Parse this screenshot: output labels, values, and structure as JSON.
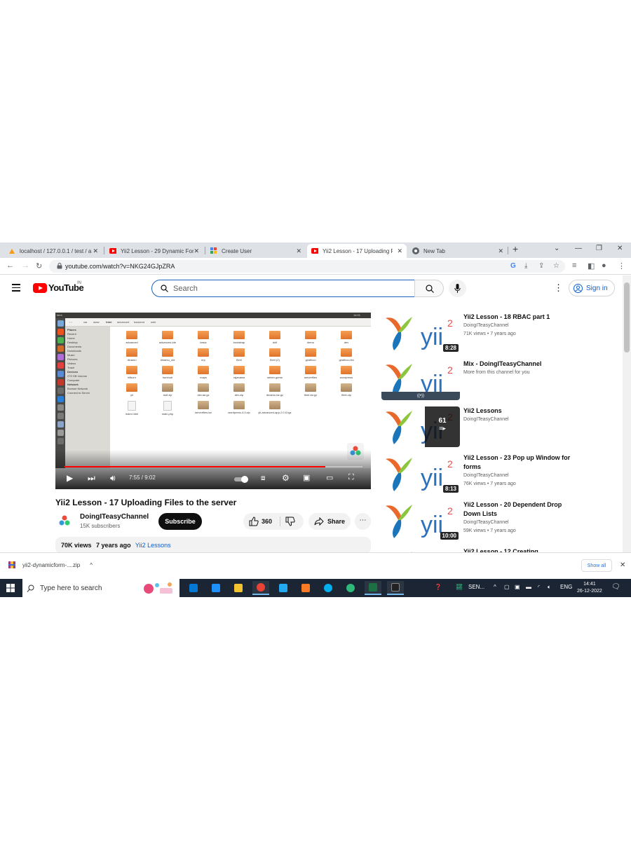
{
  "browser": {
    "tabs": [
      {
        "title": "localhost / 127.0.0.1 / test / a",
        "favicon": "phpmyadmin-icon",
        "active": false
      },
      {
        "title": "Yii2 Lesson - 29 Dynamic For",
        "favicon": "youtube-icon",
        "active": false
      },
      {
        "title": "Create User",
        "favicon": "yii-icon",
        "active": false
      },
      {
        "title": "Yii2 Lesson - 17 Uploading F",
        "favicon": "youtube-icon",
        "active": true
      },
      {
        "title": "New Tab",
        "favicon": "chrome-icon",
        "active": false
      }
    ],
    "new_tab_label": "+",
    "url": "youtube.com/watch?v=NKG24GJpZRA"
  },
  "youtube": {
    "logo_text": "YouTube",
    "country_code": "IN",
    "search_placeholder": "Search",
    "sign_in_label": "Sign in"
  },
  "video": {
    "title": "Yii2 Lesson - 17 Uploading Files to the server",
    "time_current": "7:55",
    "time_total": "9:02",
    "time_display": "7:55 / 9:02",
    "progress_fraction": 0.875,
    "channel_name": "DoingITeasyChannel",
    "subscribers": "15K subscribers",
    "subscribe_label": "Subscribe",
    "likes": "360",
    "share_label": "Share",
    "views": "70K views",
    "age": "7 years ago",
    "playlist": "Yii2 Lessons"
  },
  "file_manager": {
    "title": "html",
    "path": [
      "var",
      "www",
      "html",
      "advanced",
      "backend",
      "web"
    ],
    "clock": "14:01",
    "places_header": "Places",
    "places": [
      "Recent",
      "Home",
      "Desktop",
      "Documents",
      "Downloads",
      "Music",
      "Pictures",
      "Videos",
      "Trash"
    ],
    "devices_header": "Devices",
    "devices": [
      "279 GB Volume",
      "Computer"
    ],
    "network_header": "Network",
    "network": [
      "Browse Network",
      "Connect to Server"
    ],
    "items": [
      {
        "name": "advanced",
        "kind": "folder"
      },
      {
        "name": "advanced-ide",
        "kind": "folder"
      },
      {
        "name": "basic",
        "kind": "folder"
      },
      {
        "name": "bootstrap",
        "kind": "folder"
      },
      {
        "name": "dolf",
        "kind": "folder"
      },
      {
        "name": "demo",
        "kind": "folder"
      },
      {
        "name": "dev",
        "kind": "folder"
      },
      {
        "name": "dinamu",
        "kind": "folder"
      },
      {
        "name": "dinamu_old",
        "kind": "folder"
      },
      {
        "name": "erp",
        "kind": "folder"
      },
      {
        "name": "fleet",
        "kind": "folder"
      },
      {
        "name": "fleet (2)",
        "kind": "folder"
      },
      {
        "name": "geafinco",
        "kind": "folder"
      },
      {
        "name": "geafinco-fra",
        "kind": "folder"
      },
      {
        "name": "hilburn",
        "kind": "folder"
      },
      {
        "name": "humhub",
        "kind": "folder"
      },
      {
        "name": "maps",
        "kind": "folder"
      },
      {
        "name": "rajanawa",
        "kind": "folder"
      },
      {
        "name": "sebex-gems",
        "kind": "folder"
      },
      {
        "name": "serverfiles",
        "kind": "folder"
      },
      {
        "name": "wordpress",
        "kind": "folder"
      },
      {
        "name": "yii",
        "kind": "folder"
      },
      {
        "name": "dolf.zip",
        "kind": "archive"
      },
      {
        "name": "dev.tar.gz",
        "kind": "archive"
      },
      {
        "name": "dev.zip",
        "kind": "archive"
      },
      {
        "name": "dinamu.tar.gz",
        "kind": "archive"
      },
      {
        "name": "fleet.tar.gz",
        "kind": "archive"
      },
      {
        "name": "fleet.zip",
        "kind": "archive"
      },
      {
        "name": "index.html",
        "kind": "doc"
      },
      {
        "name": "main.php",
        "kind": "doc"
      },
      {
        "name": "serverfiles.tar",
        "kind": "archive"
      },
      {
        "name": "wordpress-4.0.zip",
        "kind": "archive"
      },
      {
        "name": "yii-advanced-app-2.0.6.tgz",
        "kind": "archive"
      }
    ]
  },
  "recommendations": [
    {
      "title": "Yii2 Lesson - 18 RBAC part 1",
      "channel": "DoingITeasyChannel",
      "meta": "71K views • 7 years ago",
      "duration": "8:28",
      "badge": ""
    },
    {
      "title": "Mix - DoingITeasyChannel",
      "channel": "More from this channel for you",
      "meta": "",
      "duration": "",
      "badge": "((•))"
    },
    {
      "title": "Yii2 Lessons",
      "channel": "DoingITeasyChannel",
      "meta": "",
      "duration": "",
      "badge": "",
      "playlist_count": "61"
    },
    {
      "title": "Yii2 Lesson - 23 Pop up Window for forms",
      "channel": "DoingITeasyChannel",
      "meta": "76K views • 7 years ago",
      "duration": "8:13",
      "badge": ""
    },
    {
      "title": "Yii2 Lesson - 20 Dependent Drop Down Lists",
      "channel": "DoingITeasyChannel",
      "meta": "59K views • 7 years ago",
      "duration": "10:00",
      "badge": ""
    },
    {
      "title": "Yii2 Lesson - 12 Creating",
      "channel": "",
      "meta": "",
      "duration": "",
      "badge": ""
    }
  ],
  "thumbnail_text": "yii",
  "thumbnail_superscript": "2",
  "download_bar": {
    "filename": "yii2-dynamicform-....zip",
    "show_all_label": "Show all"
  },
  "taskbar": {
    "search_placeholder": "Type here to search",
    "tray_label": "SEN...",
    "language": "ENG",
    "time": "14:41",
    "date": "26-12-2022"
  },
  "colors": {
    "youtube_red": "#ff0000",
    "link_blue": "#065fd4",
    "taskbar": "#1b2533"
  }
}
